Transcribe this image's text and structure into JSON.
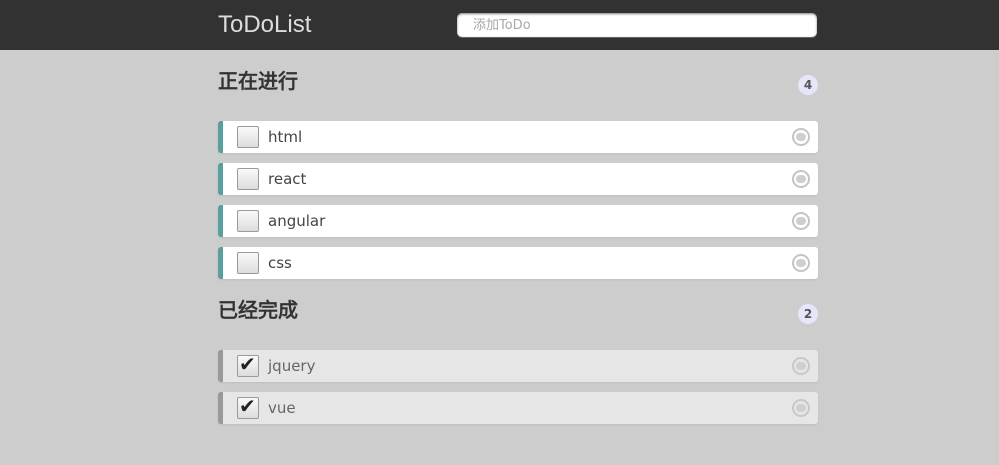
{
  "header": {
    "brand": "ToDoList",
    "input_placeholder": "添加ToDo"
  },
  "doing": {
    "title": "正在进行",
    "count": "4",
    "items": [
      {
        "text": "html",
        "checked": false
      },
      {
        "text": "react",
        "checked": false
      },
      {
        "text": "angular",
        "checked": false
      },
      {
        "text": "css",
        "checked": false
      }
    ]
  },
  "done": {
    "title": "已经完成",
    "count": "2",
    "items": [
      {
        "text": "jquery",
        "checked": true
      },
      {
        "text": "vue",
        "checked": true
      }
    ]
  },
  "colors": {
    "header_bg": "#323232",
    "page_bg": "#cdcdcd",
    "doing_accent": "#56a0a0",
    "done_accent": "#999999",
    "count_badge_bg": "#e6e6fa"
  }
}
